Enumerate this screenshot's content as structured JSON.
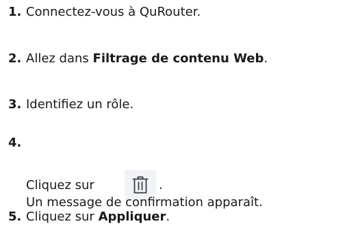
{
  "steps": [
    {
      "number": "1.",
      "text": "Connectez-vous à QuRouter."
    },
    {
      "number": "2.",
      "prefix": "Allez dans ",
      "bold": "Filtrage de contenu Web",
      "suffix": "."
    },
    {
      "number": "3.",
      "text": "Identifiez un rôle."
    },
    {
      "number": "4.",
      "prefix": "Cliquez sur ",
      "suffix": ".",
      "icon": "trash-icon",
      "note": "Un message de confirmation apparaît."
    },
    {
      "number": "5.",
      "prefix": "Cliquez sur ",
      "bold": "Appliquer",
      "suffix": "."
    }
  ]
}
